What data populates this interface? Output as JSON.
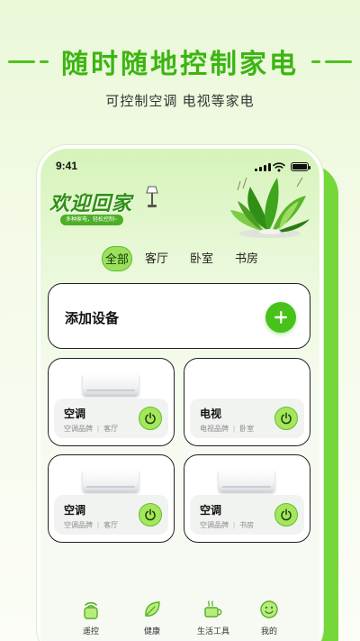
{
  "promo": {
    "title": "随时随地控制家电",
    "subtitle": "可控制空调  电视等家电"
  },
  "status_bar": {
    "time": "9:41"
  },
  "banner": {
    "welcome": "欢迎回家",
    "tag": "多种家电，轻松控制~"
  },
  "tabs": [
    {
      "label": "全部",
      "active": true
    },
    {
      "label": "客厅",
      "active": false
    },
    {
      "label": "卧室",
      "active": false
    },
    {
      "label": "书房",
      "active": false
    }
  ],
  "add_device": {
    "label": "添加设备"
  },
  "devices": [
    {
      "name": "空调",
      "brand": "空调品牌",
      "room": "客厅"
    },
    {
      "name": "电视",
      "brand": "电视品牌",
      "room": "卧室"
    },
    {
      "name": "空调",
      "brand": "空调品牌",
      "room": "客厅"
    },
    {
      "name": "空调",
      "brand": "空调品牌",
      "room": "书房"
    }
  ],
  "bottom_nav": [
    {
      "label": "遥控",
      "icon": "remote-icon"
    },
    {
      "label": "健康",
      "icon": "leaf-icon"
    },
    {
      "label": "生活工具",
      "icon": "cup-icon"
    },
    {
      "label": "我的",
      "icon": "smile-icon"
    }
  ],
  "colors": {
    "accent": "#46c21b",
    "title_green": "#3cb512",
    "phone_side": "#74d83b"
  }
}
